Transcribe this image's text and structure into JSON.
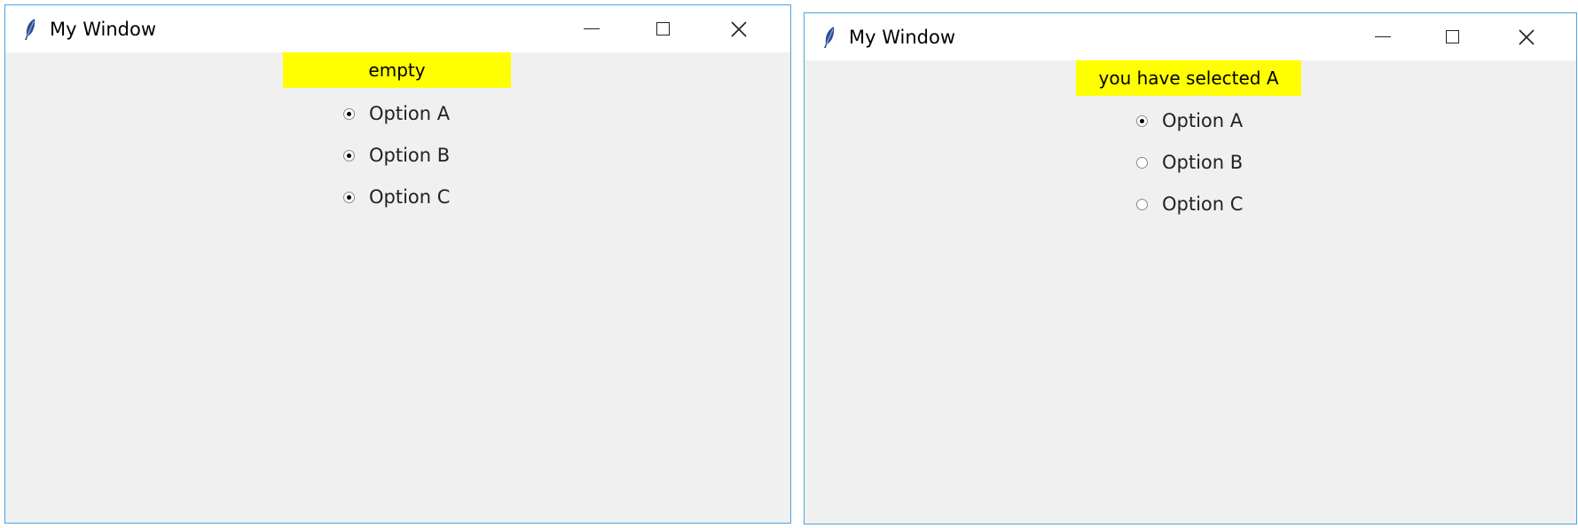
{
  "windows": [
    {
      "title": "My Window",
      "status_label": "empty",
      "options": [
        {
          "label": "Option A",
          "selected": true
        },
        {
          "label": "Option B",
          "selected": true
        },
        {
          "label": "Option C",
          "selected": true
        }
      ]
    },
    {
      "title": "My Window",
      "status_label": "you have selected A",
      "options": [
        {
          "label": "Option A",
          "selected": true
        },
        {
          "label": "Option B",
          "selected": false
        },
        {
          "label": "Option C",
          "selected": false
        }
      ]
    }
  ],
  "colors": {
    "window_border": "#4aa3df",
    "status_background": "#ffff00",
    "content_background": "#f0f0f0"
  },
  "icons": {
    "app": "feather-icon",
    "minimize": "minimize-icon",
    "maximize": "maximize-icon",
    "close": "close-icon"
  }
}
